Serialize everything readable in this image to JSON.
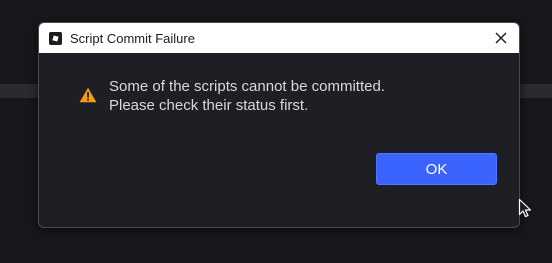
{
  "dialog": {
    "title": "Script Commit Failure",
    "message_lines": [
      "Some of the scripts cannot be committed.",
      "Please check their status first."
    ],
    "ok_label": "OK",
    "icons": {
      "app": "roblox-studio-icon",
      "close": "close-icon",
      "warning": "warning-icon"
    }
  },
  "colors": {
    "background": "#17181c",
    "dialog_background": "#1e1f24",
    "titlebar": "#ffffff",
    "primary_button": "#3b64ff",
    "warning": "#f59b1b",
    "message_text": "#d8d9dc"
  }
}
